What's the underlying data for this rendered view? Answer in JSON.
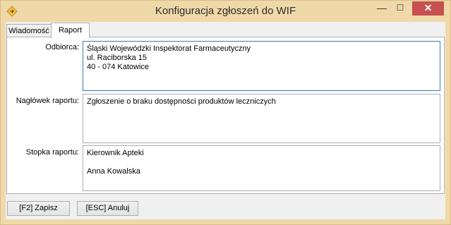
{
  "window": {
    "title": "Konfiguracja zgłoszeń do WIF",
    "app_icon": "folder-arrow-icon",
    "minimize_glyph": "—",
    "maximize_glyph": "☐",
    "close_glyph": "✕"
  },
  "tabs": [
    {
      "label": "Wiadomość",
      "active": false
    },
    {
      "label": "Raport",
      "active": true
    }
  ],
  "form": {
    "recipient_label": "Odbiorca:",
    "recipient_value": "Śląski Wojewódzki Inspektorat Farmaceutyczny\nul. Raciborska 15\n40 - 074 Katowice",
    "header_label": "Nagłówek raportu:",
    "header_value": "Zgłoszenie o braku dostępności produktów leczniczych",
    "footer_label": "Stopka raportu:",
    "footer_value": "Kierownik Apteki\n\nAnna Kowalska"
  },
  "buttons": {
    "save_label": "[F2] Zapisz",
    "cancel_label": "[ESC] Anuluj"
  },
  "colors": {
    "frame": "#f0d9a8",
    "close": "#c75050",
    "focus_border": "#3d7bad"
  }
}
